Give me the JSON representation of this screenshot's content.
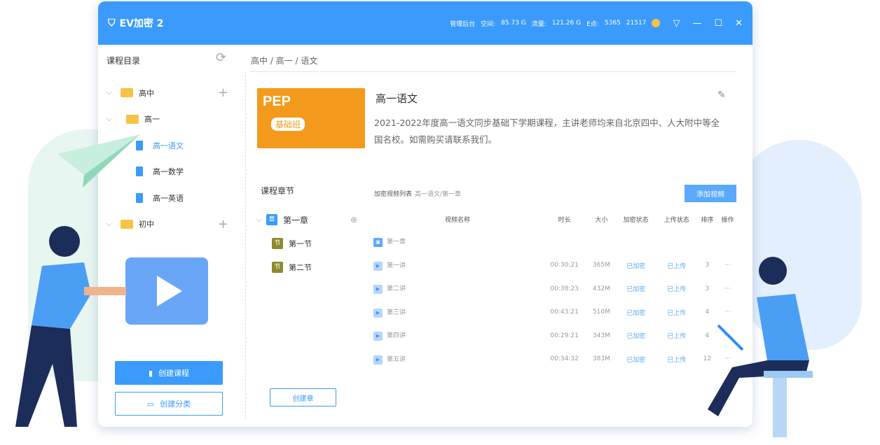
{
  "app": {
    "title": "EV加密 2",
    "admin": "管理后台",
    "space_label": "空间:",
    "space": "85.73 G",
    "traffic_label": "流量:",
    "traffic": "121.26 G",
    "epoints_label": "E点:",
    "epoints": "5365",
    "user_id": "21517"
  },
  "sidebar": {
    "header": "课程目录",
    "items": [
      {
        "label": "高中"
      },
      {
        "label": "高一"
      },
      {
        "label": "高一语文"
      },
      {
        "label": "高一数学"
      },
      {
        "label": "高一英语"
      },
      {
        "label": "初中"
      }
    ],
    "create_course": "创建课程",
    "create_category": "创建分类"
  },
  "breadcrumb": "高中 / 高一 / 语文",
  "course": {
    "cover_title": "PEP",
    "cover_sub": "基础班",
    "title": "高一语文",
    "description": "2021-2022年度高一语文同步基础下学期课程，主讲老师均来自北京四中、人大附中等全国名校。如需购买请联系我们。"
  },
  "chapters": {
    "header": "课程章节",
    "chapter_badge": "章",
    "section_badge": "节",
    "items": [
      {
        "label": "第一章"
      },
      {
        "label": "第一节"
      },
      {
        "label": "第二节"
      }
    ],
    "create": "创建章"
  },
  "videos": {
    "header": "加密视频列表",
    "path": "高一语文/第一章",
    "add": "添加视频",
    "columns": [
      "视频名称",
      "时长",
      "大小",
      "加密状态",
      "上传状态",
      "排序",
      "操作"
    ],
    "chapter_row": "第一章",
    "rows": [
      {
        "name": "第一讲",
        "duration": "00:30:21",
        "size": "365M",
        "enc": "已加密",
        "upload": "已上传",
        "order": "3",
        "op": "···"
      },
      {
        "name": "第二讲",
        "duration": "00:38:23",
        "size": "432M",
        "enc": "已加密",
        "upload": "已上传",
        "order": "3",
        "op": "···"
      },
      {
        "name": "第三讲",
        "duration": "00:43:21",
        "size": "510M",
        "enc": "已加密",
        "upload": "已上传",
        "order": "4",
        "op": "···"
      },
      {
        "name": "第四讲",
        "duration": "00:29:21",
        "size": "343M",
        "enc": "已加密",
        "upload": "已上传",
        "order": "4",
        "op": "···"
      },
      {
        "name": "第五讲",
        "duration": "00:34:32",
        "size": "383M",
        "enc": "已加密",
        "upload": "已上传",
        "order": "12",
        "op": "···"
      }
    ]
  },
  "colors": {
    "primary": "#3a9bfc",
    "folder": "#f6c344"
  }
}
